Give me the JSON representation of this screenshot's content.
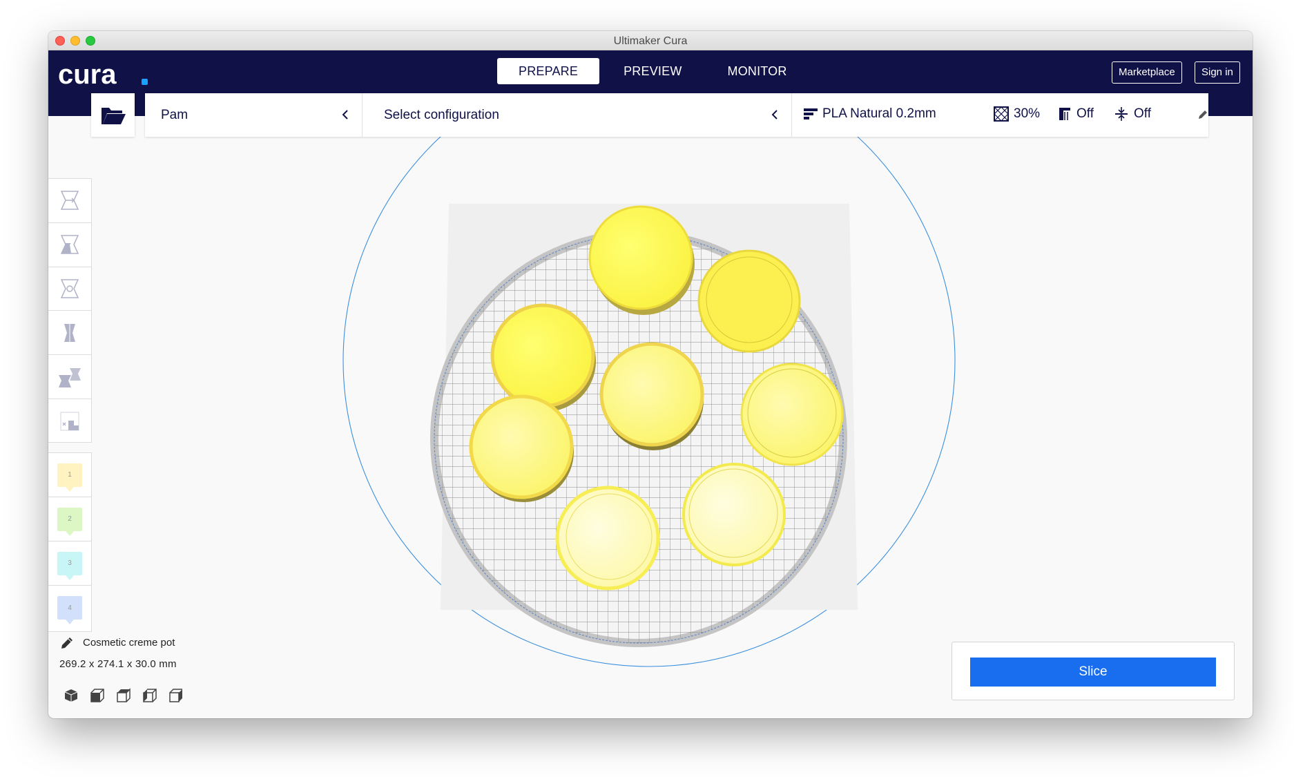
{
  "window": {
    "title": "Ultimaker Cura"
  },
  "header": {
    "logo_text": "cura",
    "tabs": [
      {
        "label": "PREPARE",
        "active": true
      },
      {
        "label": "PREVIEW",
        "active": false
      },
      {
        "label": "MONITOR",
        "active": false
      }
    ],
    "marketplace_label": "Marketplace",
    "signin_label": "Sign in"
  },
  "toolbar": {
    "printer": "Pam",
    "configuration": "Select configuration",
    "profile": "PLA Natural 0.2mm",
    "infill": "30%",
    "support": "Off",
    "adhesion": "Off"
  },
  "tools": [
    {
      "name": "move-tool-icon"
    },
    {
      "name": "scale-tool-icon"
    },
    {
      "name": "rotate-tool-icon"
    },
    {
      "name": "mirror-tool-icon"
    },
    {
      "name": "per-model-settings-icon"
    },
    {
      "name": "support-blocker-icon"
    }
  ],
  "extruders": [
    {
      "label": "1",
      "color": "#fff3c2"
    },
    {
      "label": "2",
      "color": "#dcf7c4"
    },
    {
      "label": "3",
      "color": "#c8f6f6"
    },
    {
      "label": "4",
      "color": "#d3e0fb"
    }
  ],
  "object": {
    "name": "Cosmetic creme pot",
    "dimensions": "269.2 x 274.1 x 30.0 mm"
  },
  "slice": {
    "label": "Slice"
  },
  "colors": {
    "header_bg": "#0f1147",
    "slice_blue": "#196ef0",
    "logo_accent": "#19a1ff",
    "object_yellow": "#fff94a"
  }
}
